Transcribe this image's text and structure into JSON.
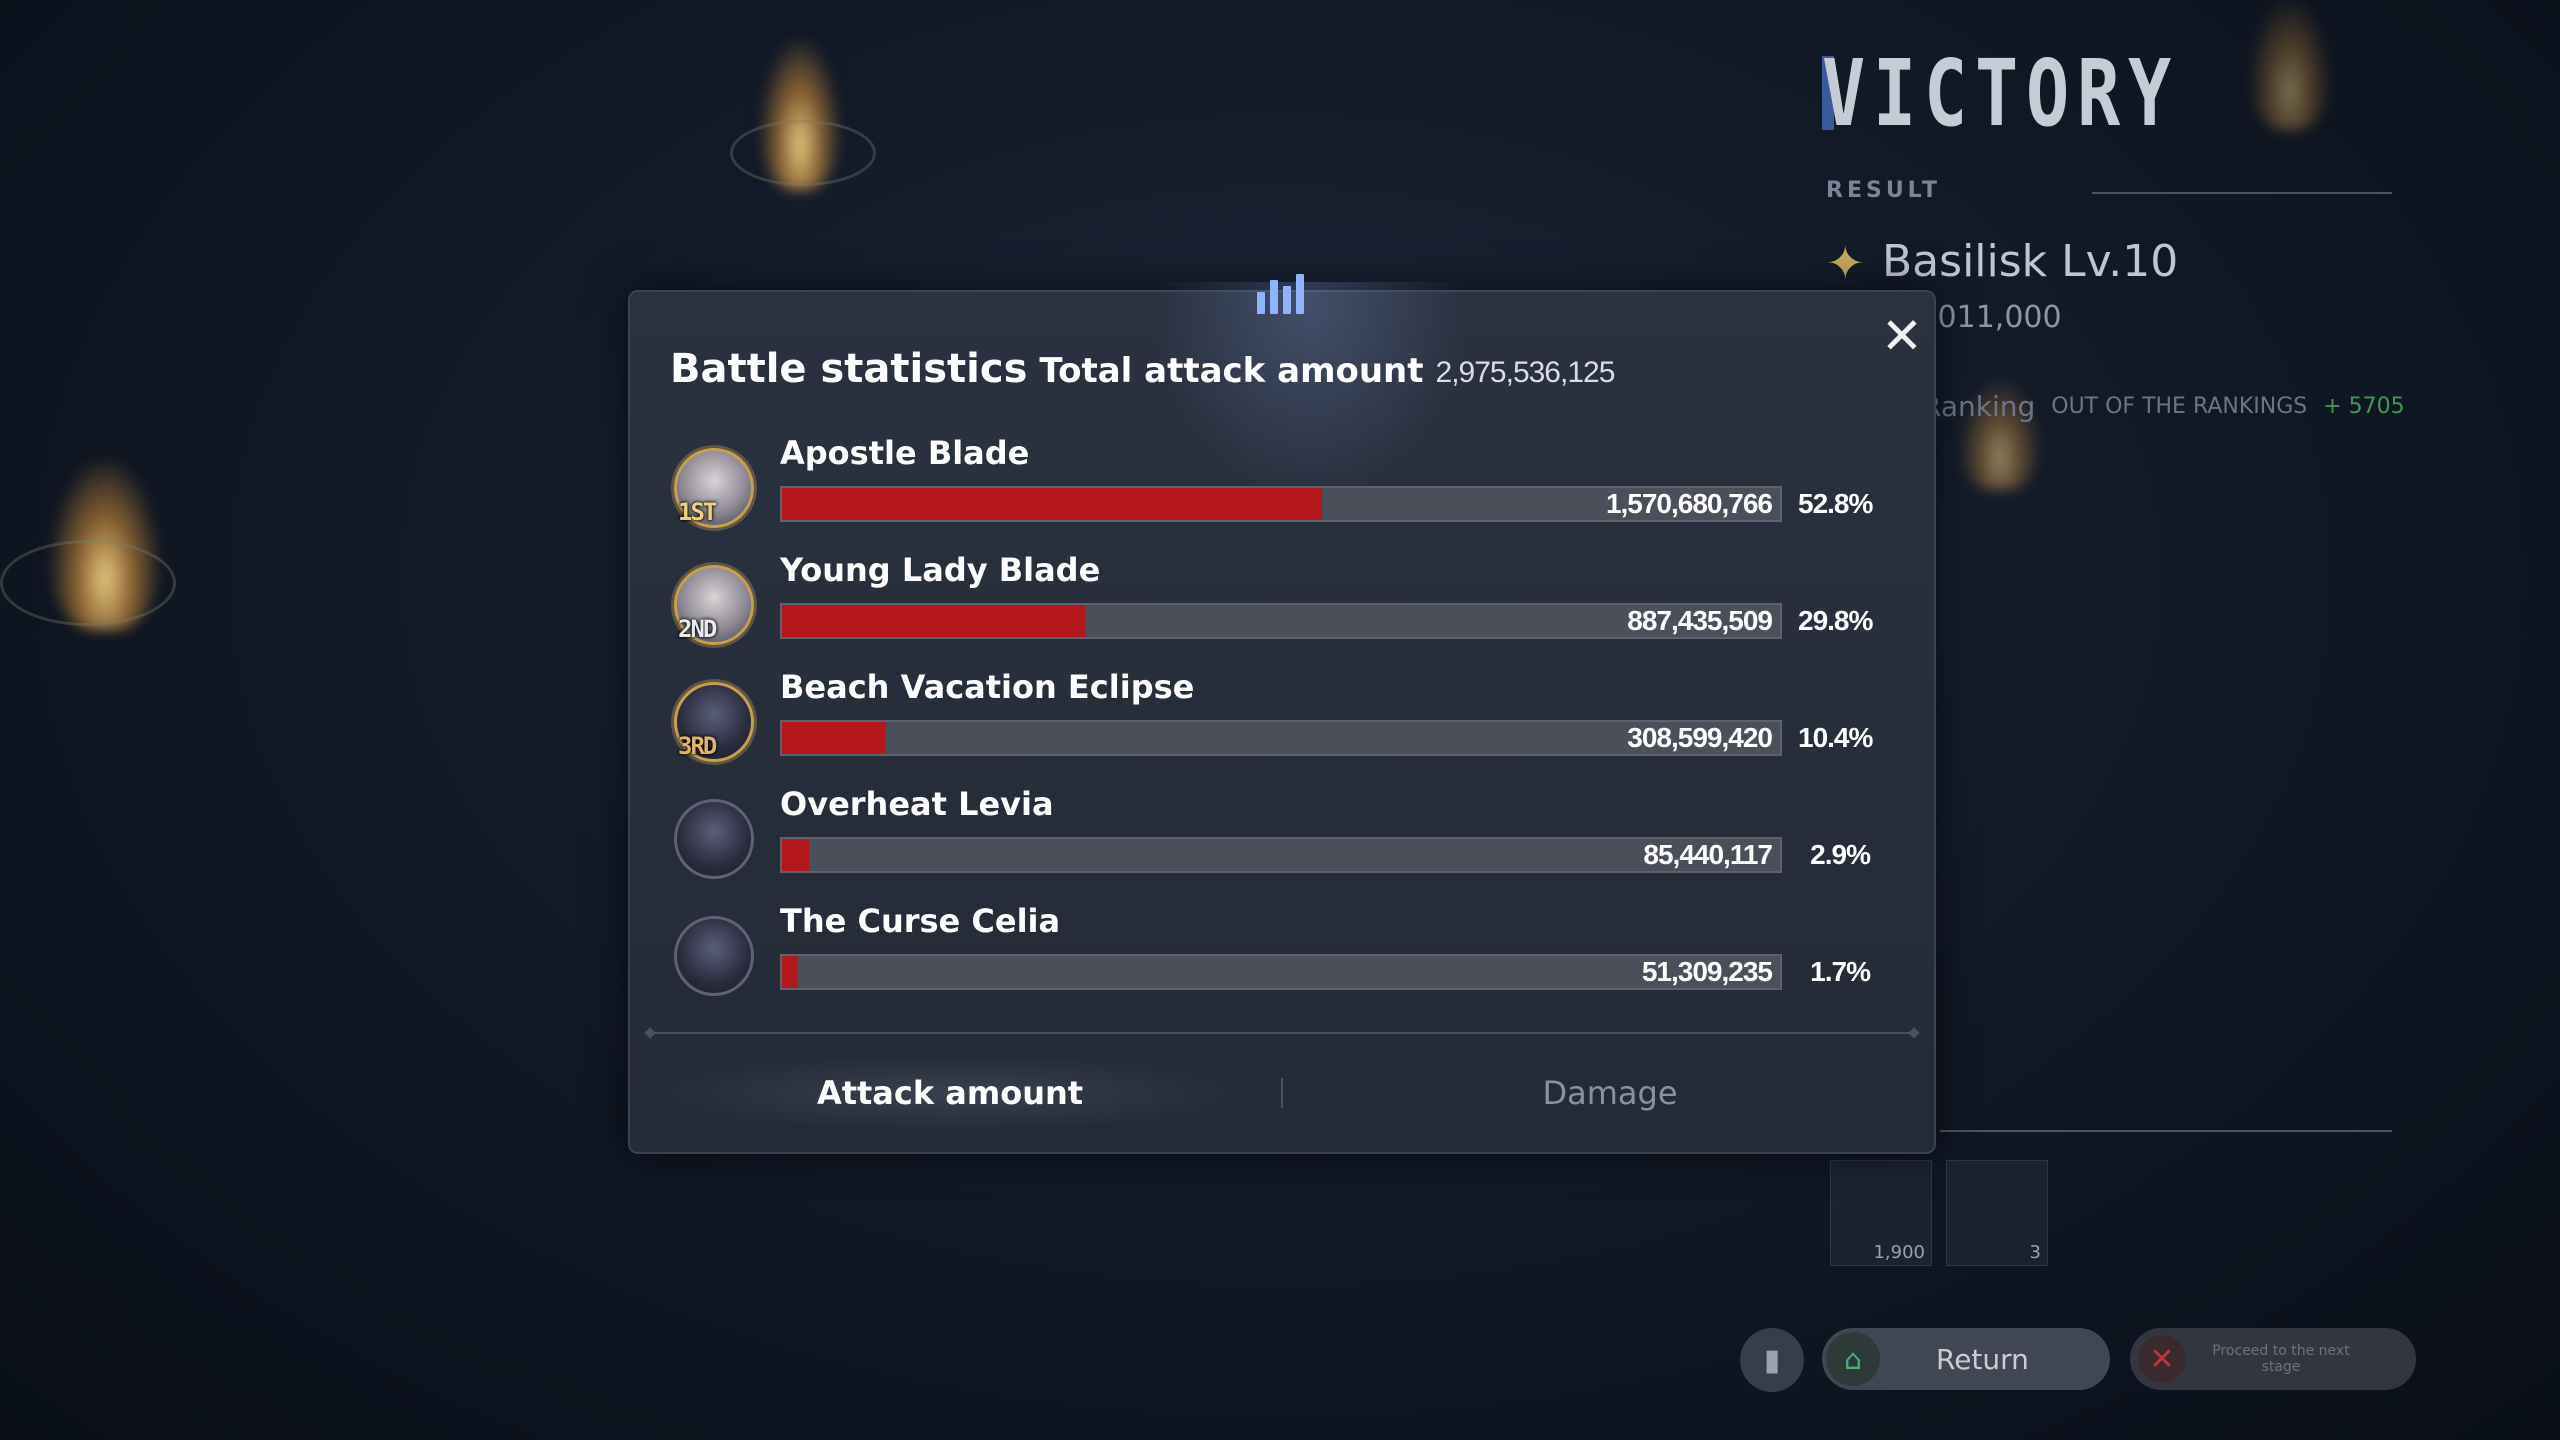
{
  "background": {
    "victory_title": "VICTORY",
    "result_label": "RESULT",
    "boss_name": "Basilisk Lv.10",
    "boss_hp": ",011,000",
    "ranking_label": "Ranking",
    "ranking_status": "OUT OF THE RANKINGS",
    "ranking_points": "+ 5705",
    "rewards": [
      {
        "icon": "gift-box-icon",
        "qty": "1,900"
      },
      {
        "icon": "ticket-icon",
        "qty": "3"
      }
    ],
    "return_label": "Return",
    "proceed_label": "Proceed to the next stage"
  },
  "modal": {
    "title": "Battle statistics",
    "total_label": "Total attack amount",
    "total_value": "2,975,536,125",
    "close_icon": "close-icon",
    "header_icon": "bar-chart-icon",
    "tabs": [
      {
        "label": "Attack amount",
        "active": true
      },
      {
        "label": "Damage",
        "active": false
      }
    ]
  },
  "chart_data": {
    "type": "bar",
    "title": "Battle statistics",
    "categories": [
      "Apostle Blade",
      "Young Lady Blade",
      "Beach Vacation Eclipse",
      "Overheat Levia",
      "The Curse Celia"
    ],
    "values": [
      1570680766,
      887435509,
      308599420,
      85440117,
      51309235
    ],
    "value_labels": [
      "1,570,680,766",
      "887,435,509",
      "308,599,420",
      "85,440,117",
      "51,309,235"
    ],
    "percent_labels": [
      "52.8%",
      "29.8%",
      "10.4%",
      "2.9%",
      "1.7%"
    ],
    "ranks": [
      "1ST",
      "2ND",
      "3RD",
      "",
      ""
    ],
    "bar_color": "#b4181c",
    "track_color": "#4a4f5a"
  }
}
